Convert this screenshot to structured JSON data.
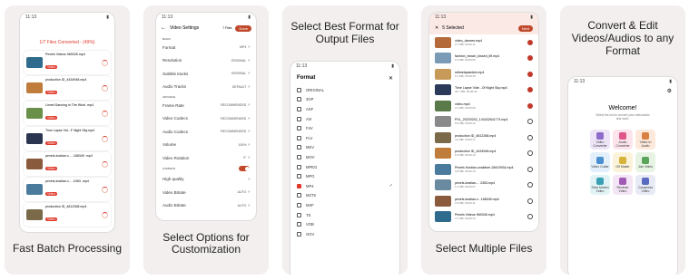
{
  "captions": {
    "p1": "Fast Batch Processing",
    "p2_line1": "Select Options for",
    "p2_line2": "Customization",
    "p3_line1": "Select Best Format for",
    "p3_line2": "Output Files",
    "p4": "Select Multiple Files",
    "p5_line1": "Convert & Edit",
    "p5_line2": "Videos/Audios to any",
    "p5_line3": "Format"
  },
  "status_time": "11:13",
  "batch": {
    "progress_text": "1/7 Files Converted - (49%)",
    "files": [
      {
        "name": "Pexels Videos 969345.mp4",
        "badge": "Video",
        "color": "#2f6b8c"
      },
      {
        "name": "production ID_4434948.mp4",
        "badge": "Video",
        "color": "#c07c3a"
      },
      {
        "name": "Linnet Dancing in The Wind .mp4",
        "badge": "Video",
        "color": "#6a8f4a"
      },
      {
        "name": "Time Lapse Vid...F Night Sky.mp4",
        "badge": "Video",
        "color": "#2c3550"
      },
      {
        "name": "pexels-kostian-v... -168349 .mp4",
        "badge": "Video",
        "color": "#8a5a3c"
      },
      {
        "name": "pexels-kostian-v... -2453 .mp4",
        "badge": "Video",
        "color": "#4a7a9c"
      },
      {
        "name": "production ID_4812268.mp4",
        "badge": "Video",
        "color": "#7a6a4a"
      }
    ]
  },
  "settings": {
    "title": "Video Settings",
    "files_label": "7 Files",
    "done_label": "Done",
    "section_basic": "BASIC",
    "section_advance": "ADVANCE",
    "section_common": "COMMON",
    "rows_basic": [
      {
        "label": "Format",
        "value": "MP4"
      },
      {
        "label": "Resolution",
        "value": "ORIGINAL"
      },
      {
        "label": "Subtitle tracks",
        "value": "ORIGINAL"
      },
      {
        "label": "Audio Tracks",
        "value": "DEFAULT"
      }
    ],
    "rows_advance": [
      {
        "label": "Frame Rate",
        "value": "RECOMMENDED"
      },
      {
        "label": "Video Codecs",
        "value": "RECOMMENDED"
      },
      {
        "label": "Audio Codecs",
        "value": "RECOMMENDED"
      },
      {
        "label": "Volume",
        "value": "100%"
      },
      {
        "label": "Video Rotation",
        "value": "0°"
      }
    ],
    "rows_common": [
      {
        "label": "High quality",
        "value": ""
      },
      {
        "label": "Video Bitrate",
        "value": "AUTO"
      },
      {
        "label": "Audio Bitrate",
        "value": "AUTO"
      }
    ]
  },
  "format": {
    "title": "Format",
    "close_glyph": "✕",
    "selected_index": 10,
    "items": [
      "ORIGINAL",
      "3GP",
      "ASF",
      "AVI",
      "F4V",
      "FLV",
      "MKV",
      "MOV",
      "MPEG",
      "MPG",
      "MP4",
      "M2TS",
      "MXF",
      "TS",
      "VOB",
      "OGV"
    ]
  },
  "select": {
    "count_label": "5 Selected",
    "next_label": "Next",
    "items": [
      {
        "name": "video_dances.mp4",
        "size": "3.7 MB, 00:00:11",
        "checked": true,
        "color": "#b56a3a"
      },
      {
        "name": "fashion_beach_kissed_lift.mp4",
        "size": "1.6 MB, 00:00:05",
        "checked": true,
        "color": "#7a9ab5"
      },
      {
        "name": "mtimelapsedub.mp4",
        "size": "5.1 MB, 00:00:15",
        "checked": true,
        "color": "#c89a5a"
      },
      {
        "name": "Time Lapse Vide...Of Night Sky.mp4",
        "size": "35.7 MB, 00:00:42",
        "checked": true,
        "color": "#2c3a5a"
      },
      {
        "name": "video.mp4",
        "size": "3.1 MB, 00:00:09",
        "checked": true,
        "color": "#5a7a4a"
      },
      {
        "name": "PXL_20220202_143432642.TS.mp4",
        "size": "9.5 MB, 00:00:12",
        "checked": false,
        "color": "#8a8a8a"
      },
      {
        "name": "production ID_4812268.mp4",
        "size": "4.2 MB, 00:00:17",
        "checked": false,
        "color": "#7a6a4a"
      },
      {
        "name": "production ID_4434948.mp4",
        "size": "6.3 MB, 00:00:14",
        "checked": false,
        "color": "#c07c3a"
      },
      {
        "name": "Pexels Kostian-ovaldiver-28419934.mp4",
        "size": "2.8 MB, 00:00:10",
        "checked": false,
        "color": "#4a7a9c"
      },
      {
        "name": "pexels-kostian-... 2453.mp4",
        "size": "1.2 MB, 00:00:07",
        "checked": false,
        "color": "#6a8aa0"
      },
      {
        "name": "pexels-kostian-v...168349.mp4",
        "size": "3.3 MB, 00:00:11",
        "checked": false,
        "color": "#8a5a3c"
      },
      {
        "name": "Pexels Videos 969345.mp4",
        "size": "4.7 MB, 00:00:13",
        "checked": false,
        "color": "#2f6b8c"
      }
    ]
  },
  "home": {
    "welcome": "Welcome!",
    "subtitle": "Select the tool to convert your video/audio and more.",
    "tiles": [
      {
        "label": "Video Converter",
        "bg": "#ede5f7",
        "ic": "#8e6bc9"
      },
      {
        "label": "Audio Converter",
        "bg": "#fde4ec",
        "ic": "#e0568a"
      },
      {
        "label": "Video to Audio",
        "bg": "#fde9dc",
        "ic": "#d98145"
      },
      {
        "label": "Video Cutter",
        "bg": "#e3f0fb",
        "ic": "#4a90d0"
      },
      {
        "label": "Gif Maker",
        "bg": "#fbf3d9",
        "ic": "#d7b23a"
      },
      {
        "label": "Join Video",
        "bg": "#e7f4e4",
        "ic": "#5aa55a"
      },
      {
        "label": "Slow Motion Video",
        "bg": "#e2f3f6",
        "ic": "#3aa0b5"
      },
      {
        "label": "Reverse Video",
        "bg": "#f3e5f5",
        "ic": "#a05ab5"
      },
      {
        "label": "Compress Video",
        "bg": "#e8eaf6",
        "ic": "#5a6ac0"
      }
    ]
  }
}
